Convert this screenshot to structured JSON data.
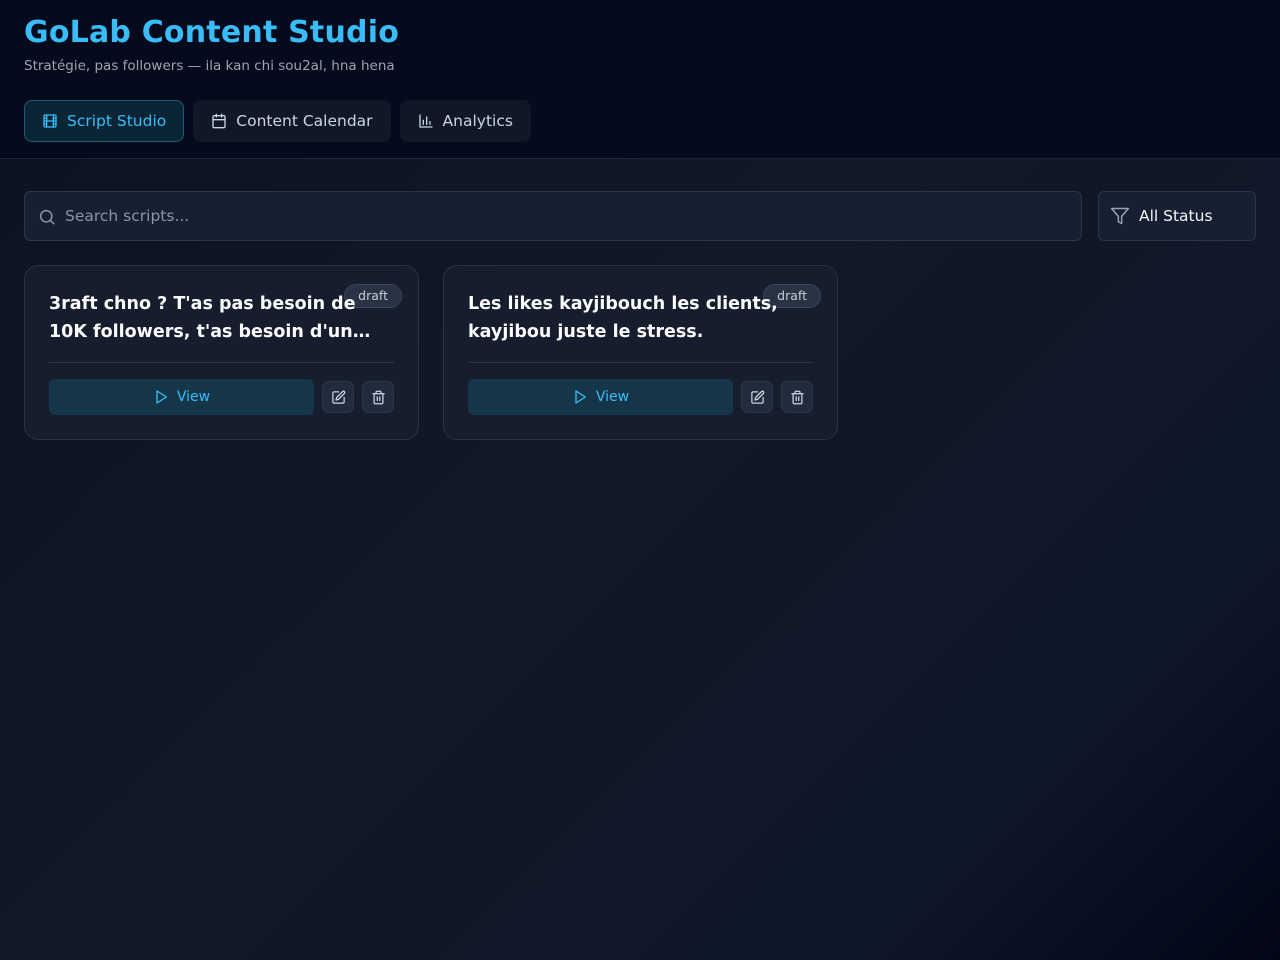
{
  "app": {
    "title": "GoLab Content Studio",
    "subtitle": "Stratégie, pas followers — ila kan chi sou2al, hna hena"
  },
  "tabs": [
    {
      "label": "Script Studio",
      "icon": "film-icon",
      "active": true
    },
    {
      "label": "Content Calendar",
      "icon": "calendar-icon",
      "active": false
    },
    {
      "label": "Analytics",
      "icon": "bar-chart-icon",
      "active": false
    }
  ],
  "search": {
    "placeholder": "Search scripts...",
    "value": ""
  },
  "filter": {
    "selected": "All Status",
    "icon": "filter-icon"
  },
  "scripts": [
    {
      "title": "3raft chno ? T'as pas besoin de 10K followers, t'as besoin d'un…",
      "status": "draft",
      "view_label": "View"
    },
    {
      "title": "Les likes kayjibouch les clients, kayjibou juste le stress.",
      "status": "draft",
      "view_label": "View"
    }
  ],
  "colors": {
    "accent": "#38bdf8",
    "header_bg": "#050b1d",
    "card_bg": "#161e2e",
    "badge_bg": "#2a3344"
  }
}
